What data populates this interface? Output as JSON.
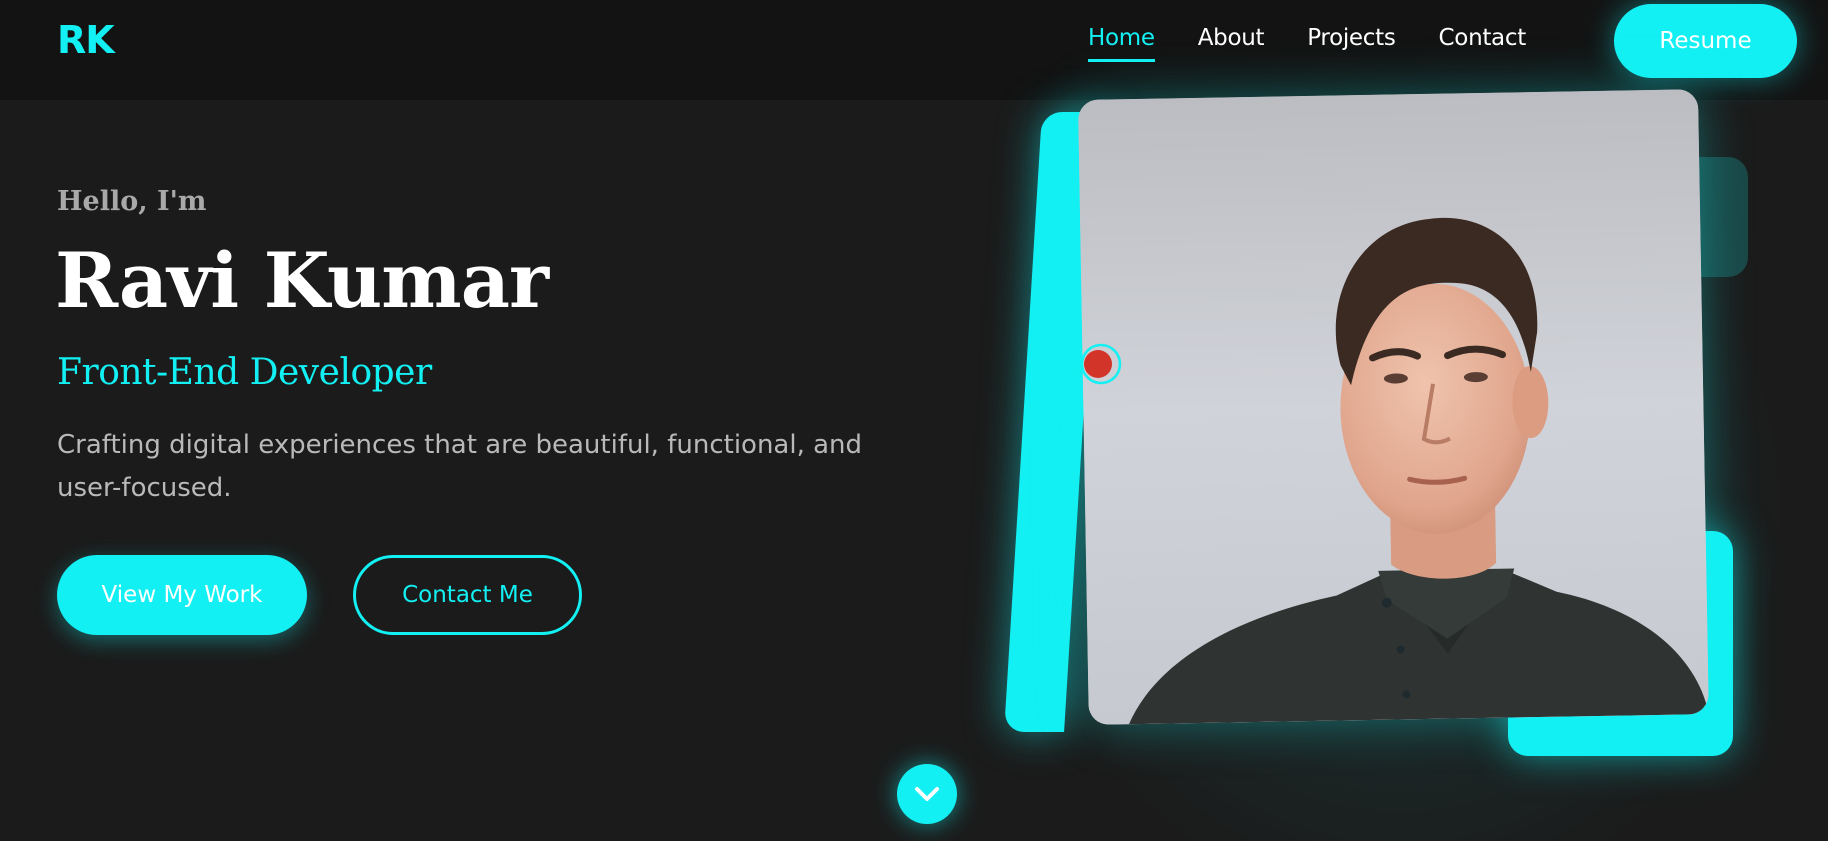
{
  "header": {
    "logo": "RK",
    "nav": [
      {
        "label": "Home",
        "active": true
      },
      {
        "label": "About",
        "active": false
      },
      {
        "label": "Projects",
        "active": false
      },
      {
        "label": "Contact",
        "active": false
      }
    ],
    "resume_label": "Resume"
  },
  "hero": {
    "greeting": "Hello, I'm",
    "name": "Ravi Kumar",
    "role": "Front-End Developer",
    "description": "Crafting digital experiences that are beautiful, functional, and user-focused.",
    "primary_button": "View My Work",
    "secondary_button": "Contact Me"
  },
  "image": {
    "alt": "Ravi Kumar portrait",
    "icon": "location-pin-icon"
  },
  "scroll": {
    "icon": "chevron-down-icon"
  },
  "colors": {
    "accent": "#13f0f3",
    "background": "#1b1b1b",
    "header": "#131313",
    "pin": "#d3342a"
  }
}
